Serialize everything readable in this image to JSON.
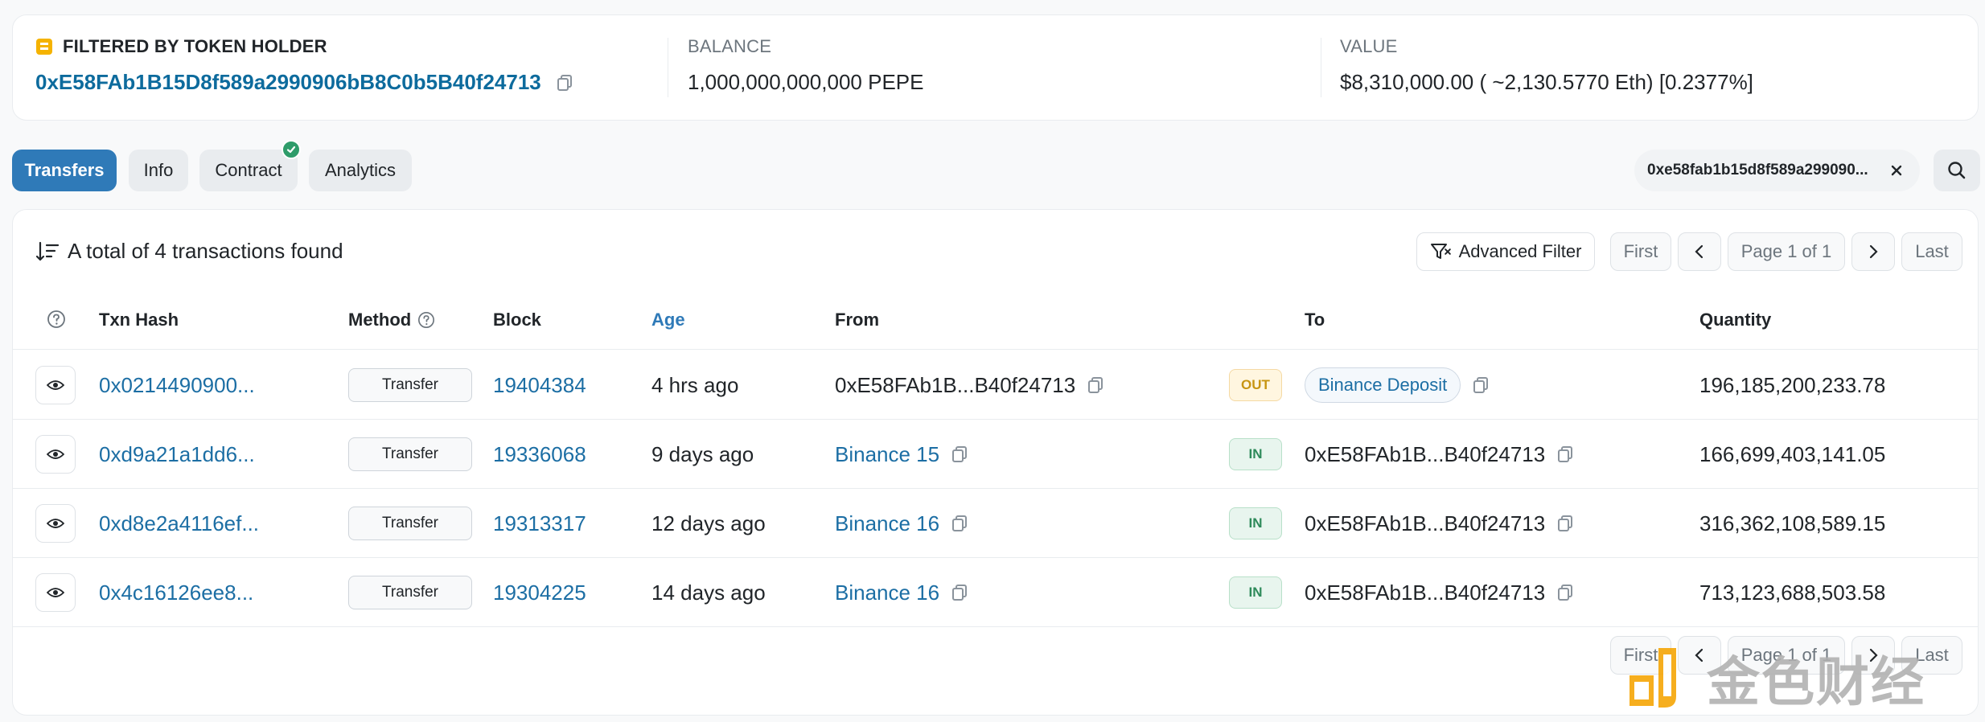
{
  "holder": {
    "label": "FILTERED BY TOKEN HOLDER",
    "address": "0xE58FAb1B15D8f589a2990906bB8C0b5B40f24713",
    "balance_label": "BALANCE",
    "balance_value": "1,000,000,000,000 PEPE",
    "value_label": "VALUE",
    "value_value": "$8,310,000.00 ( ~2,130.5770 Eth) [0.2377%]"
  },
  "tabs": [
    {
      "label": "Transfers",
      "active": true
    },
    {
      "label": "Info",
      "active": false
    },
    {
      "label": "Contract",
      "active": false,
      "verified": true
    },
    {
      "label": "Analytics",
      "active": false
    }
  ],
  "filter_chip": {
    "text": "0xe58fab1b15d8f589a299090..."
  },
  "summary": "A total of 4 transactions found",
  "toolbar": {
    "advanced_filter": "Advanced Filter",
    "first": "First",
    "page": "Page 1 of 1",
    "last": "Last"
  },
  "columns": {
    "hash": "Txn Hash",
    "method": "Method",
    "block": "Block",
    "age": "Age",
    "from": "From",
    "to": "To",
    "quantity": "Quantity"
  },
  "rows": [
    {
      "hash": "0x0214490900...",
      "method": "Transfer",
      "block": "19404384",
      "age": "4 hrs ago",
      "from": "0xE58FAb1B...B40f24713",
      "dir": "OUT",
      "to": "Binance Deposit",
      "quantity": "196,185,200,233.78"
    },
    {
      "hash": "0xd9a21a1dd6...",
      "method": "Transfer",
      "block": "19336068",
      "age": "9 days ago",
      "from": "Binance 15",
      "dir": "IN",
      "to": "0xE58FAb1B...B40f24713",
      "quantity": "166,699,403,141.05"
    },
    {
      "hash": "0xd8e2a4116ef...",
      "method": "Transfer",
      "block": "19313317",
      "age": "12 days ago",
      "from": "Binance 16",
      "dir": "IN",
      "to": "0xE58FAb1B...B40f24713",
      "quantity": "316,362,108,589.15"
    },
    {
      "hash": "0x4c16126ee8...",
      "method": "Transfer",
      "block": "19304225",
      "age": "14 days ago",
      "from": "Binance 16",
      "dir": "IN",
      "to": "0xE58FAb1B...B40f24713",
      "quantity": "713,123,688,503.58"
    }
  ],
  "bottom_pager": {
    "first": "First",
    "page": "Page 1 of 1",
    "last": "Last"
  },
  "watermark": {
    "text": "金色财经"
  },
  "colors": {
    "accent": "#2f7ab8",
    "link": "#1c6ea4",
    "in_green": "#2e8a5a",
    "out_amber": "#c79512"
  }
}
